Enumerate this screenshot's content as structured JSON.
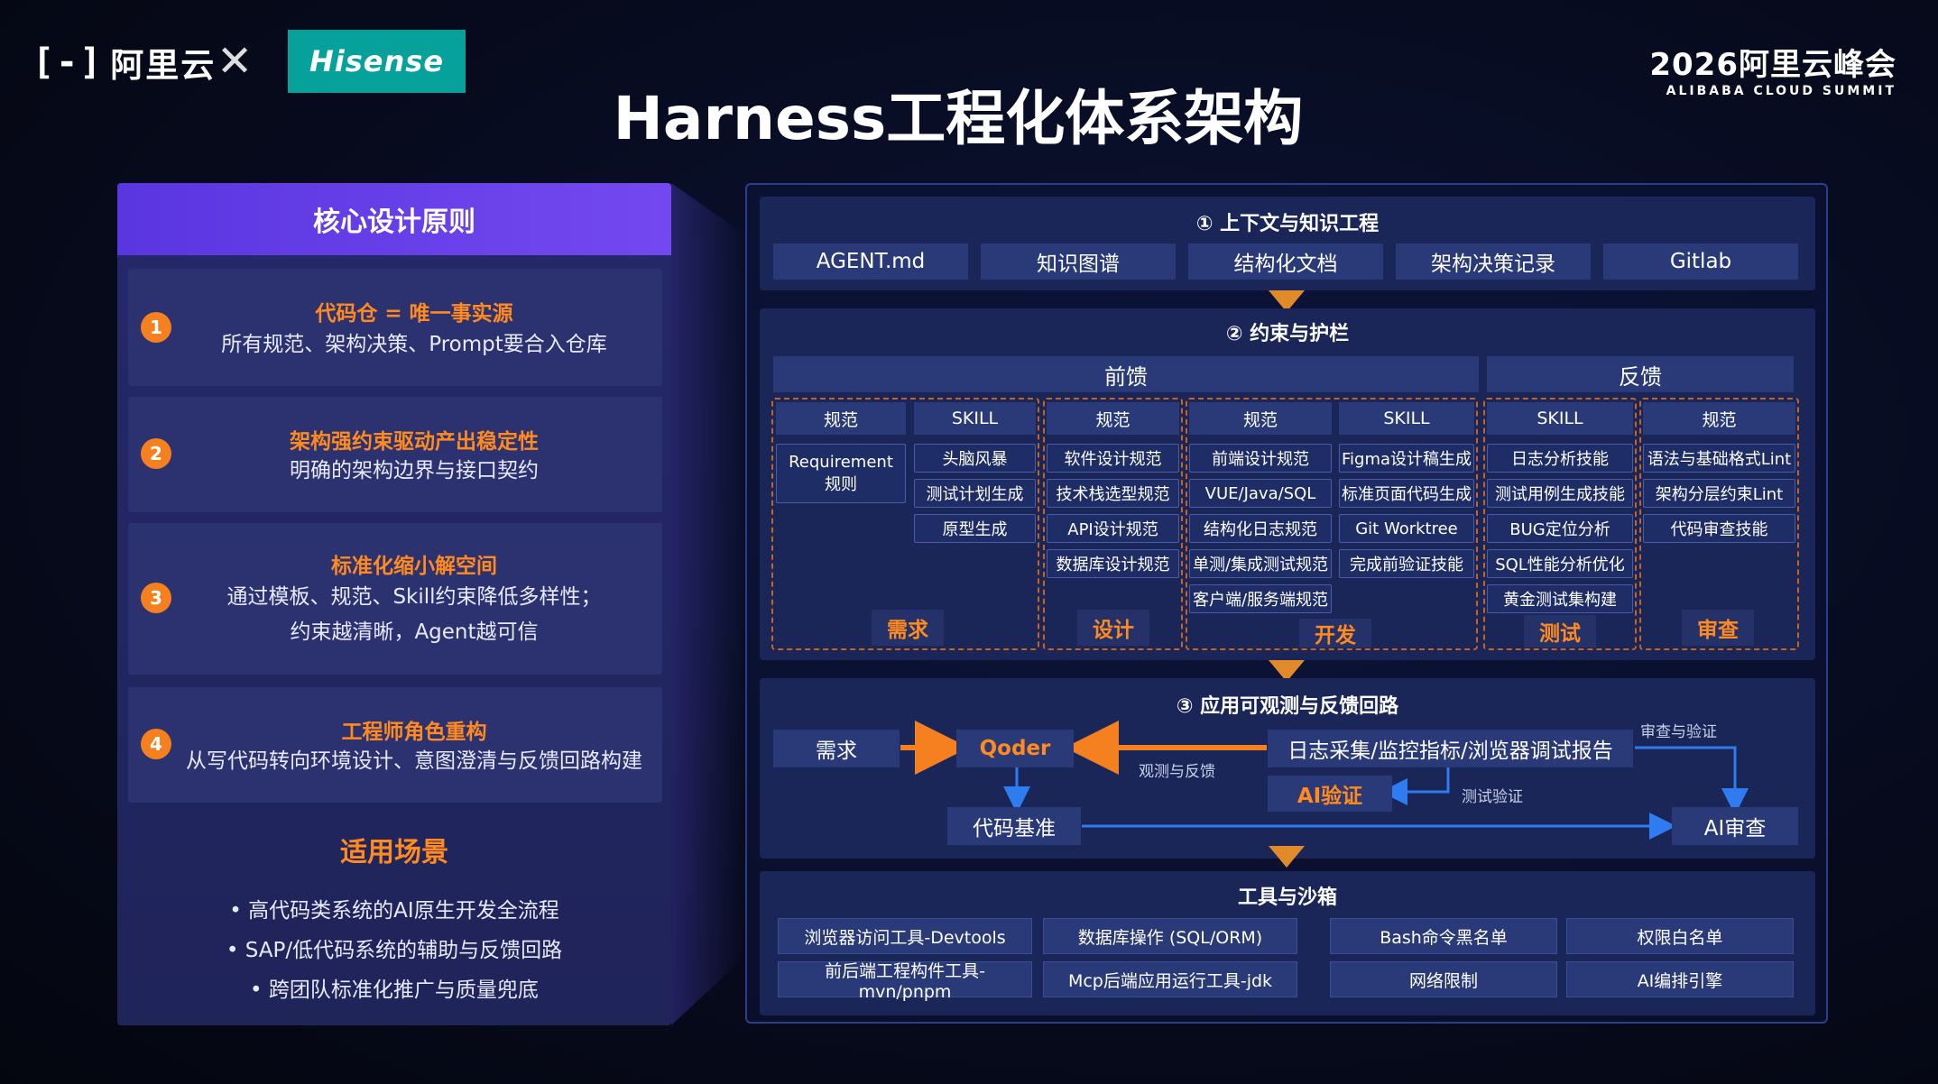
{
  "header": {
    "aliyun_logo_mark": "[-]",
    "aliyun_logo_text": "阿里云",
    "hisense_logo": "Hisense",
    "summit_title": "2026阿里云峰会",
    "summit_subtitle": "ALIBABA CLOUD SUMMIT",
    "title": "Harness工程化体系架构"
  },
  "left_panel": {
    "heading": "核心设计原则",
    "principles": [
      {
        "num": "1",
        "title": "代码仓 = 唯一事实源",
        "desc1": "所有规范、架构决策、Prompt要合入仓库",
        "desc2": ""
      },
      {
        "num": "2",
        "title": "架构强约束驱动产出稳定性",
        "desc1": "明确的架构边界与接口契约",
        "desc2": ""
      },
      {
        "num": "3",
        "title": "标准化缩小解空间",
        "desc1": "通过模板、规范、Skill约束降低多样性；",
        "desc2": "约束越清晰，Agent越可信"
      },
      {
        "num": "4",
        "title": "工程师角色重构",
        "desc1": "从写代码转向环境设计、意图澄清与反馈回路构建",
        "desc2": ""
      }
    ],
    "scenarios_title": "适用场景",
    "scenarios": [
      "• 高代码类系统的AI原生开发全流程",
      "• SAP/低代码系统的辅助与反馈回路",
      "• 跨团队标准化推广与质量兜底"
    ]
  },
  "section1": {
    "title": "① 上下文与知识工程",
    "items": [
      "AGENT.md",
      "知识图谱",
      "结构化文档",
      "架构决策记录",
      "Gitlab"
    ]
  },
  "section2": {
    "title": "② 约束与护栏",
    "feedforward": "前馈",
    "feedback": "反馈",
    "col_headers": [
      "规范",
      "SKILL",
      "规范",
      "规范",
      "SKILL",
      "SKILL",
      "规范"
    ],
    "req_rule": "Requirement 规则",
    "skill_a": [
      "头脑风暴",
      "测试计划生成",
      "原型生成"
    ],
    "design_spec": [
      "软件设计规范",
      "技术栈选型规范",
      "API设计规范",
      "数据库设计规范"
    ],
    "dev_spec": [
      "前端设计规范",
      "VUE/Java/SQL",
      "结构化日志规范",
      "单测/集成测试规范",
      "客户端/服务端规范"
    ],
    "dev_skill": [
      "Figma设计稿生成",
      "标准页面代码生成",
      "Git Worktree",
      "完成前验证技能"
    ],
    "test_skill": [
      "日志分析技能",
      "测试用例生成技能",
      "BUG定位分析",
      "SQL性能分析优化",
      "黄金测试集构建"
    ],
    "review_spec": [
      "语法与基础格式Lint",
      "架构分层约束Lint",
      "代码审查技能"
    ],
    "stages": [
      "需求",
      "设计",
      "开发",
      "测试",
      "审查"
    ]
  },
  "section3": {
    "title": "③ 应用可观测与反馈回路",
    "req": "需求",
    "qoder": "Qoder",
    "logs": "日志采集/监控指标/浏览器调试报告",
    "ai_verify": "AI验证",
    "code_base": "代码基准",
    "ai_review": "AI审查",
    "lbl_observe": "观测与反馈",
    "lbl_review_verify": "审查与验证",
    "lbl_test_verify": "测试验证"
  },
  "section4": {
    "title": "工具与沙箱",
    "tools": [
      "浏览器访问工具-Devtools",
      "数据库操作 (SQL/ORM)",
      "前后端工程构件工具-mvn/pnpm",
      "Mcp后端应用运行工具-jdk"
    ],
    "sandbox": [
      "Bash命令黑名单",
      "权限白名单",
      "网络限制",
      "AI编排引擎"
    ]
  },
  "colors": {
    "accent_orange": "#ff8a1f",
    "header_purple": "#6a40ea",
    "box_blue": "#2a3a78",
    "hisense_teal": "#06a19b"
  }
}
